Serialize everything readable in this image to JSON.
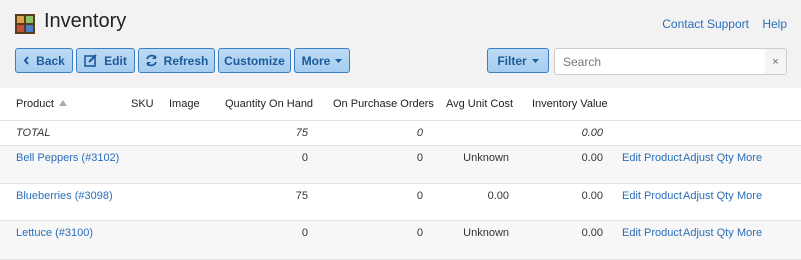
{
  "header": {
    "title": "Inventory",
    "links": [
      "Contact Support",
      "Help"
    ]
  },
  "toolbar": {
    "back": "Back",
    "edit": "Edit",
    "refresh": "Refresh",
    "customize": "Customize",
    "more": "More",
    "filter": "Filter",
    "search_placeholder": "Search",
    "clear": "×"
  },
  "table": {
    "columns": [
      "Product",
      "SKU",
      "Image",
      "Quantity On Hand",
      "On Purchase Orders",
      "Avg Unit Cost",
      "Inventory Value"
    ],
    "total": {
      "label": "TOTAL",
      "qty": "75",
      "po": "0",
      "cost": "",
      "value": "0.00"
    },
    "rows": [
      {
        "product": "Bell Peppers (#3102)",
        "qty": "0",
        "po": "0",
        "cost": "Unknown",
        "value": "0.00"
      },
      {
        "product": "Blueberries (#3098)",
        "qty": "75",
        "po": "0",
        "cost": "0.00",
        "value": "0.00"
      },
      {
        "product": "Lettuce (#3100)",
        "qty": "0",
        "po": "0",
        "cost": "Unknown",
        "value": "0.00"
      }
    ],
    "actions": {
      "edit": "Edit Product",
      "adjust": "Adjust Qty",
      "more": "More"
    }
  },
  "colors": {
    "accent": "#2a6ebb",
    "button_bg": "#a6cdf0",
    "button_border": "#3a7fc4"
  }
}
